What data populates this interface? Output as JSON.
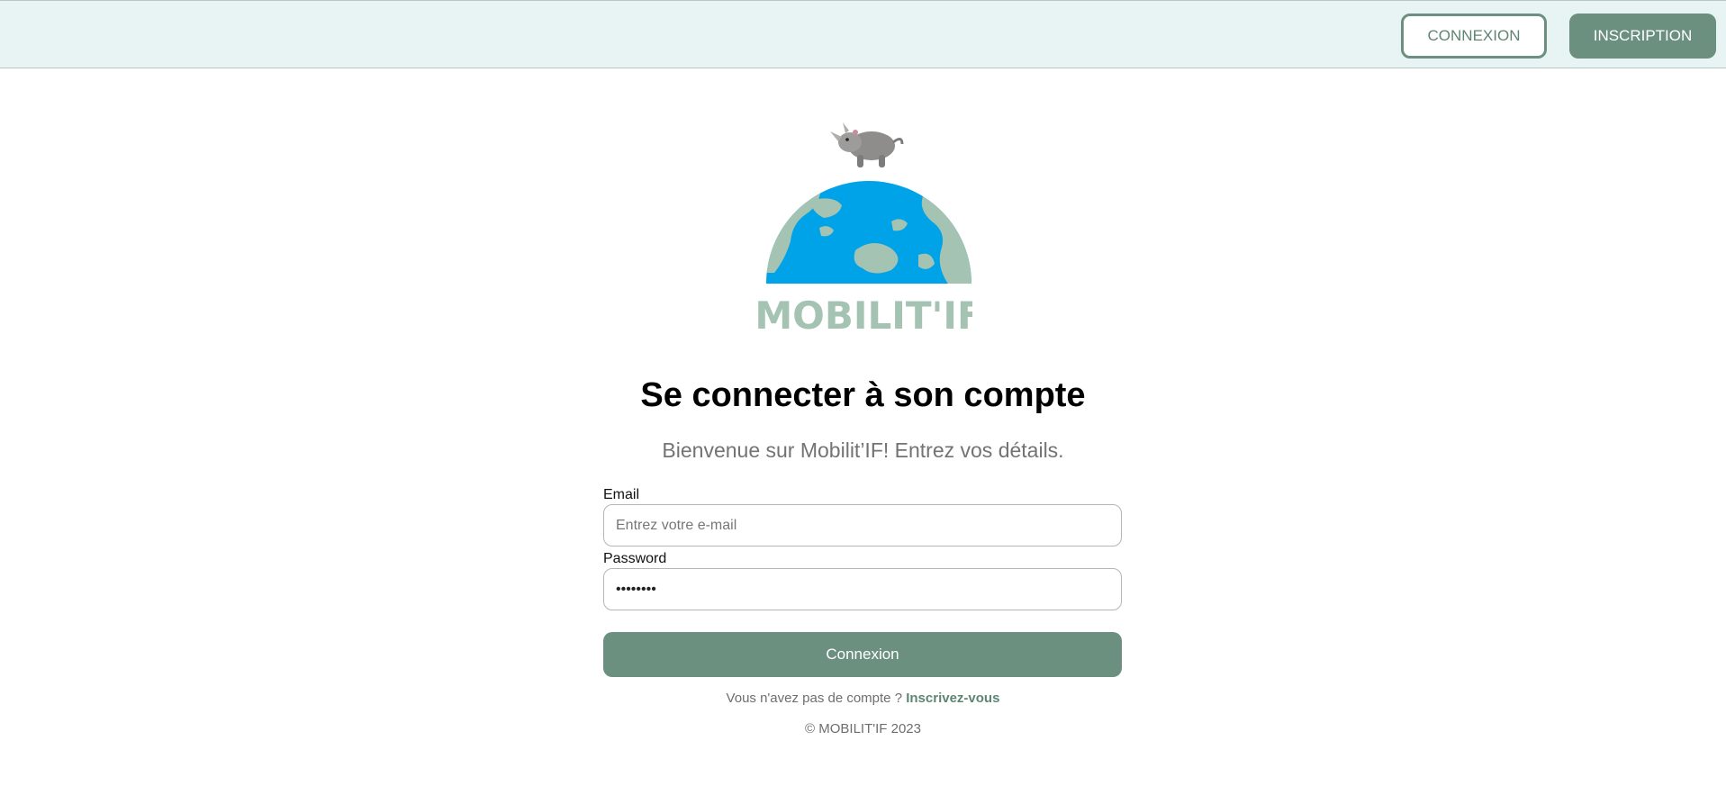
{
  "header": {
    "login_label": "CONNEXION",
    "signup_label": "INSCRIPTION"
  },
  "logo": {
    "text": "MOBILIT'IF",
    "icon": "rhino-on-globe-logo"
  },
  "login": {
    "title": "Se connecter à son compte",
    "subtitle": "Bienvenue sur Mobilit’IF! Entrez vos détails.",
    "email_label": "Email",
    "email_placeholder": "Entrez votre e-mail",
    "email_value": "",
    "password_label": "Password",
    "password_value": "••••••••",
    "submit_label": "Connexion",
    "no_account_text": "Vous n'avez pas de compte ?",
    "signup_link": "Inscrivez-vous"
  },
  "footer": {
    "copyright": "© MOBILIT'IF 2023"
  },
  "colors": {
    "accent": "#6b9080",
    "topbar_bg": "#e8f3f4",
    "globe_ocean": "#00a3e8",
    "globe_land": "#a4c3b2"
  }
}
